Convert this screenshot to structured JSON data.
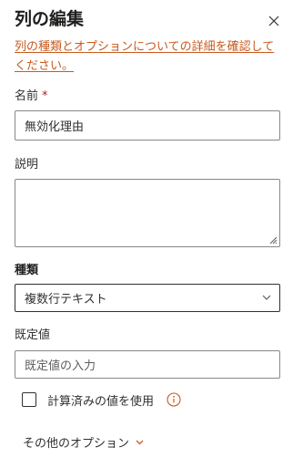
{
  "panel": {
    "title": "列の編集",
    "help_link": "列の種類とオプションについての詳細を確認してください。"
  },
  "fields": {
    "name": {
      "label": "名前",
      "required_marker": "*",
      "value": "無効化理由"
    },
    "description": {
      "label": "説明",
      "value": ""
    },
    "type": {
      "label": "種類",
      "selected": "複数行テキスト"
    },
    "default_value": {
      "label": "既定値",
      "placeholder": "既定値の入力"
    }
  },
  "calculated": {
    "label": "計算済みの値を使用",
    "checked": false
  },
  "more_options": {
    "label": "その他のオプション"
  },
  "colors": {
    "link": "#c85a1e",
    "accent_icon": "#c85a1e",
    "required": "#a4262c",
    "border": "#8a8886"
  }
}
